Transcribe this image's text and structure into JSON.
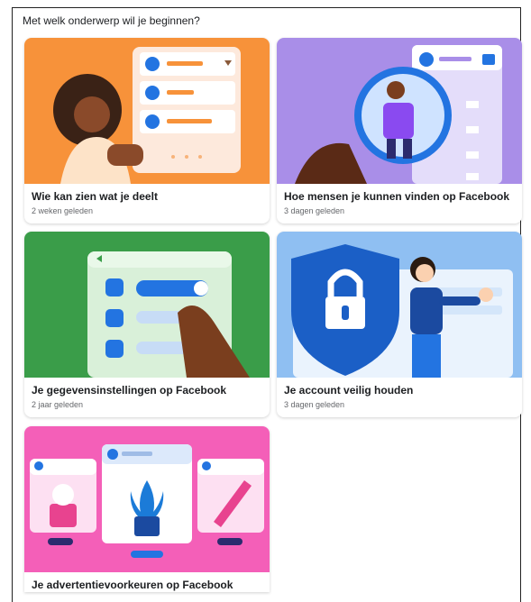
{
  "header": {
    "title": "Met welk onderwerp wil je beginnen?"
  },
  "cards": [
    {
      "title": "Wie kan zien wat je deelt",
      "subtitle": "2 weken geleden",
      "color": "#f7923a"
    },
    {
      "title": "Hoe mensen je kunnen vinden op Facebook",
      "subtitle": "3 dagen geleden",
      "color": "#a98ee8"
    },
    {
      "title": "Je gegevensinstellingen op Facebook",
      "subtitle": "2 jaar geleden",
      "color": "#3a9d49"
    },
    {
      "title": "Je account veilig houden",
      "subtitle": "3 dagen geleden",
      "color": "#8fbff2"
    },
    {
      "title": "Je advertentievoorkeuren op Facebook",
      "subtitle": "",
      "color": "#f45fb8"
    }
  ]
}
